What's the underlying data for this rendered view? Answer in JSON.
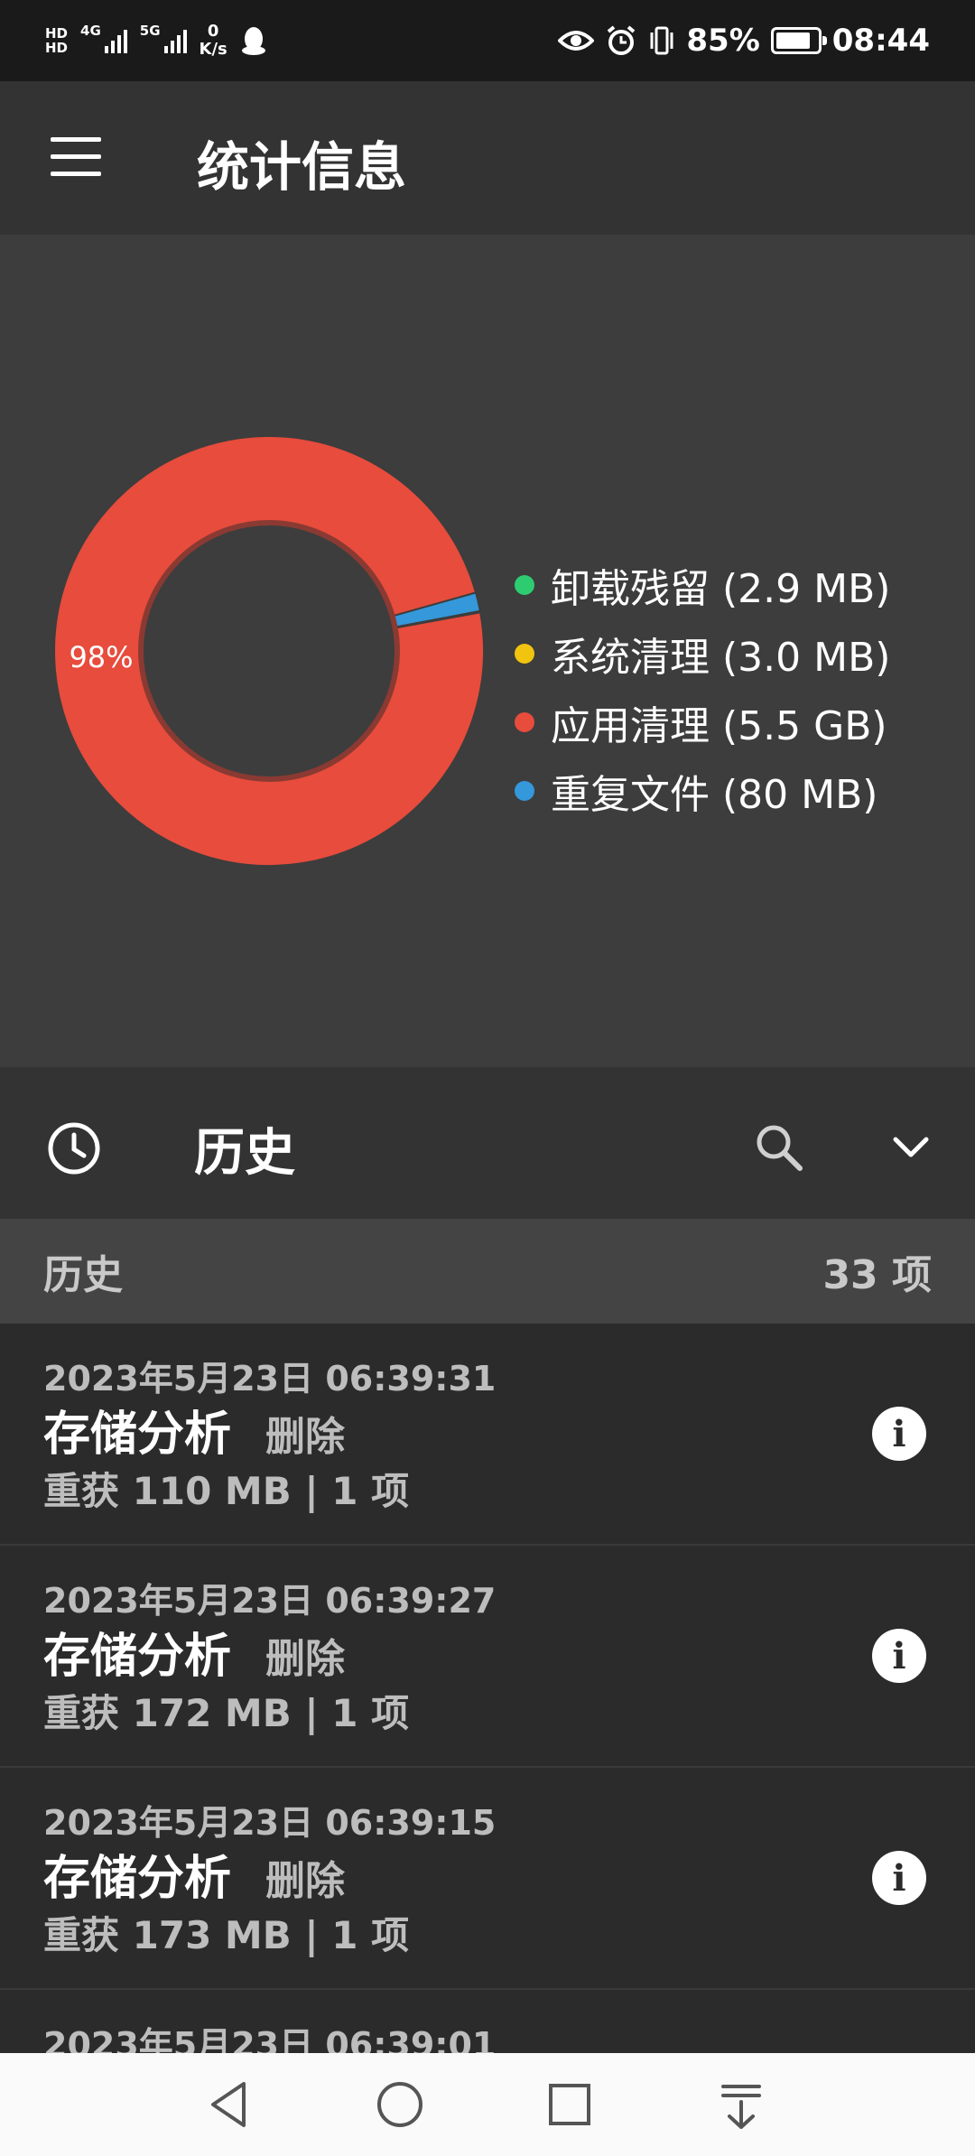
{
  "status_bar": {
    "network_1": "4G",
    "network_2": "5G",
    "speed_value": "0",
    "speed_unit": "K/s",
    "battery_percent": "85%",
    "battery_level": 0.85,
    "time": "08:44"
  },
  "app_bar": {
    "title": "统计信息"
  },
  "chart_data": {
    "type": "pie",
    "donut": true,
    "slices": [
      {
        "label": "卸载残留 (2.9 MB)",
        "value": 2.9,
        "color": "#2ecc71"
      },
      {
        "label": "系统清理 (3.0 MB)",
        "value": 3.0,
        "color": "#f1c40f"
      },
      {
        "label": "应用清理 (5.5 GB)",
        "value": 5632,
        "color": "#e74c3c"
      },
      {
        "label": "重复文件 (80 MB)",
        "value": 80,
        "color": "#3498db"
      }
    ],
    "data_labels": [
      "98%"
    ],
    "legend_position": "right"
  },
  "history_header": {
    "title": "历史"
  },
  "summary": {
    "label": "历史",
    "count": "33 项"
  },
  "history_items": [
    {
      "time": "2023年5月23日 06:39:31",
      "type": "存储分析",
      "action": "删除",
      "summary": "重获 110 MB | 1 项"
    },
    {
      "time": "2023年5月23日 06:39:27",
      "type": "存储分析",
      "action": "删除",
      "summary": "重获 172 MB | 1 项"
    },
    {
      "time": "2023年5月23日 06:39:15",
      "type": "存储分析",
      "action": "删除",
      "summary": "重获 173 MB | 1 项"
    },
    {
      "time": "2023年5月23日 06:39:01",
      "type": "",
      "action": "",
      "summary": ""
    }
  ],
  "icons": {
    "menu": "menu-icon",
    "clock": "clock-icon",
    "search": "search-icon",
    "chevron": "chevron-down-icon",
    "info": "info-icon",
    "nav_back": "back-triangle-icon",
    "nav_home": "home-circle-icon",
    "nav_recents": "recents-square-icon",
    "nav_notifications": "pull-down-icon"
  },
  "info_glyph": "i"
}
